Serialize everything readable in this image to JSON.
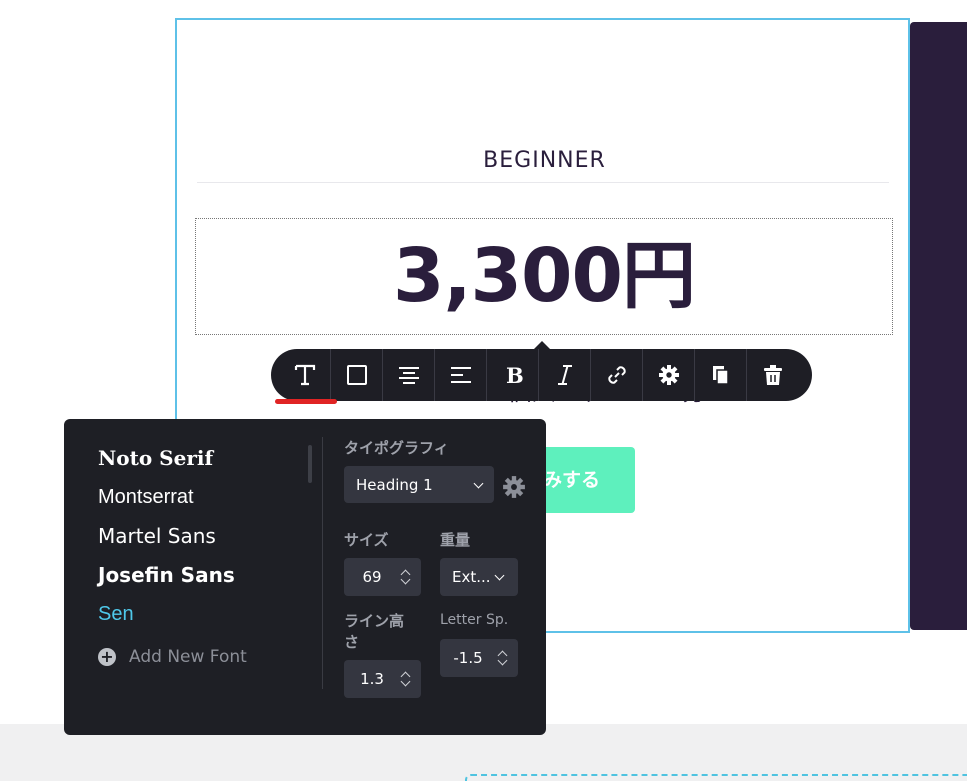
{
  "card": {
    "plan_name": "BEGINNER",
    "price": "3,300円",
    "lesson": "WordPress個人レッスン30分",
    "cta_label": "申し込みする"
  },
  "toolbar": {
    "buttons": [
      {
        "icon": "text-icon",
        "active": true
      },
      {
        "icon": "square-icon"
      },
      {
        "icon": "align-center-icon"
      },
      {
        "icon": "align-left-icon"
      },
      {
        "icon": "bold-icon"
      },
      {
        "icon": "italic-icon"
      },
      {
        "icon": "link-icon"
      },
      {
        "icon": "gear-icon"
      },
      {
        "icon": "duplicate-icon"
      },
      {
        "icon": "trash-icon"
      }
    ],
    "active_underline_color": "#e02424"
  },
  "typography_panel": {
    "fonts": [
      "Noto Serif",
      "Montserrat",
      "Martel Sans",
      "Josefin Sans",
      "Sen"
    ],
    "active_font": "Sen",
    "add_font_label": "Add New Font",
    "typography_label": "タイポグラフィ",
    "style_select": "Heading 1",
    "size_label": "サイズ",
    "size_value": "69",
    "weight_label": "重量",
    "weight_value": "Ext...",
    "line_height_label": "ライン高さ",
    "line_height_value": "1.3",
    "letter_spacing_label": "Letter Sp.",
    "letter_spacing_value": "-1.5"
  },
  "colors": {
    "accent": "#5ec1e8",
    "dark": "#2a1e3c",
    "cta": "#5ef0bd",
    "active_font": "#4fc8ea"
  }
}
